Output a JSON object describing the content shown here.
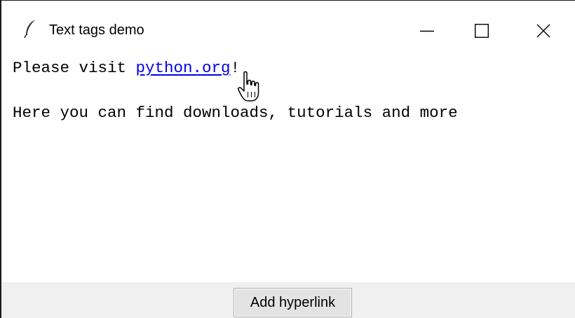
{
  "window": {
    "title": "Text tags demo",
    "icon": "feather-icon"
  },
  "title_buttons": {
    "minimize_icon": "minimize-icon",
    "maximize_icon": "maximize-icon",
    "close_icon": "close-icon"
  },
  "text_area": {
    "line1_prefix": "Please visit ",
    "link_text": "python.org",
    "line1_suffix": "!",
    "line2": "Here you can find downloads, tutorials and more",
    "link_color": "#0000ee",
    "cursor_icon": "hand-pointer-icon"
  },
  "bottom_bar": {
    "button_label": "Add hyperlink"
  }
}
